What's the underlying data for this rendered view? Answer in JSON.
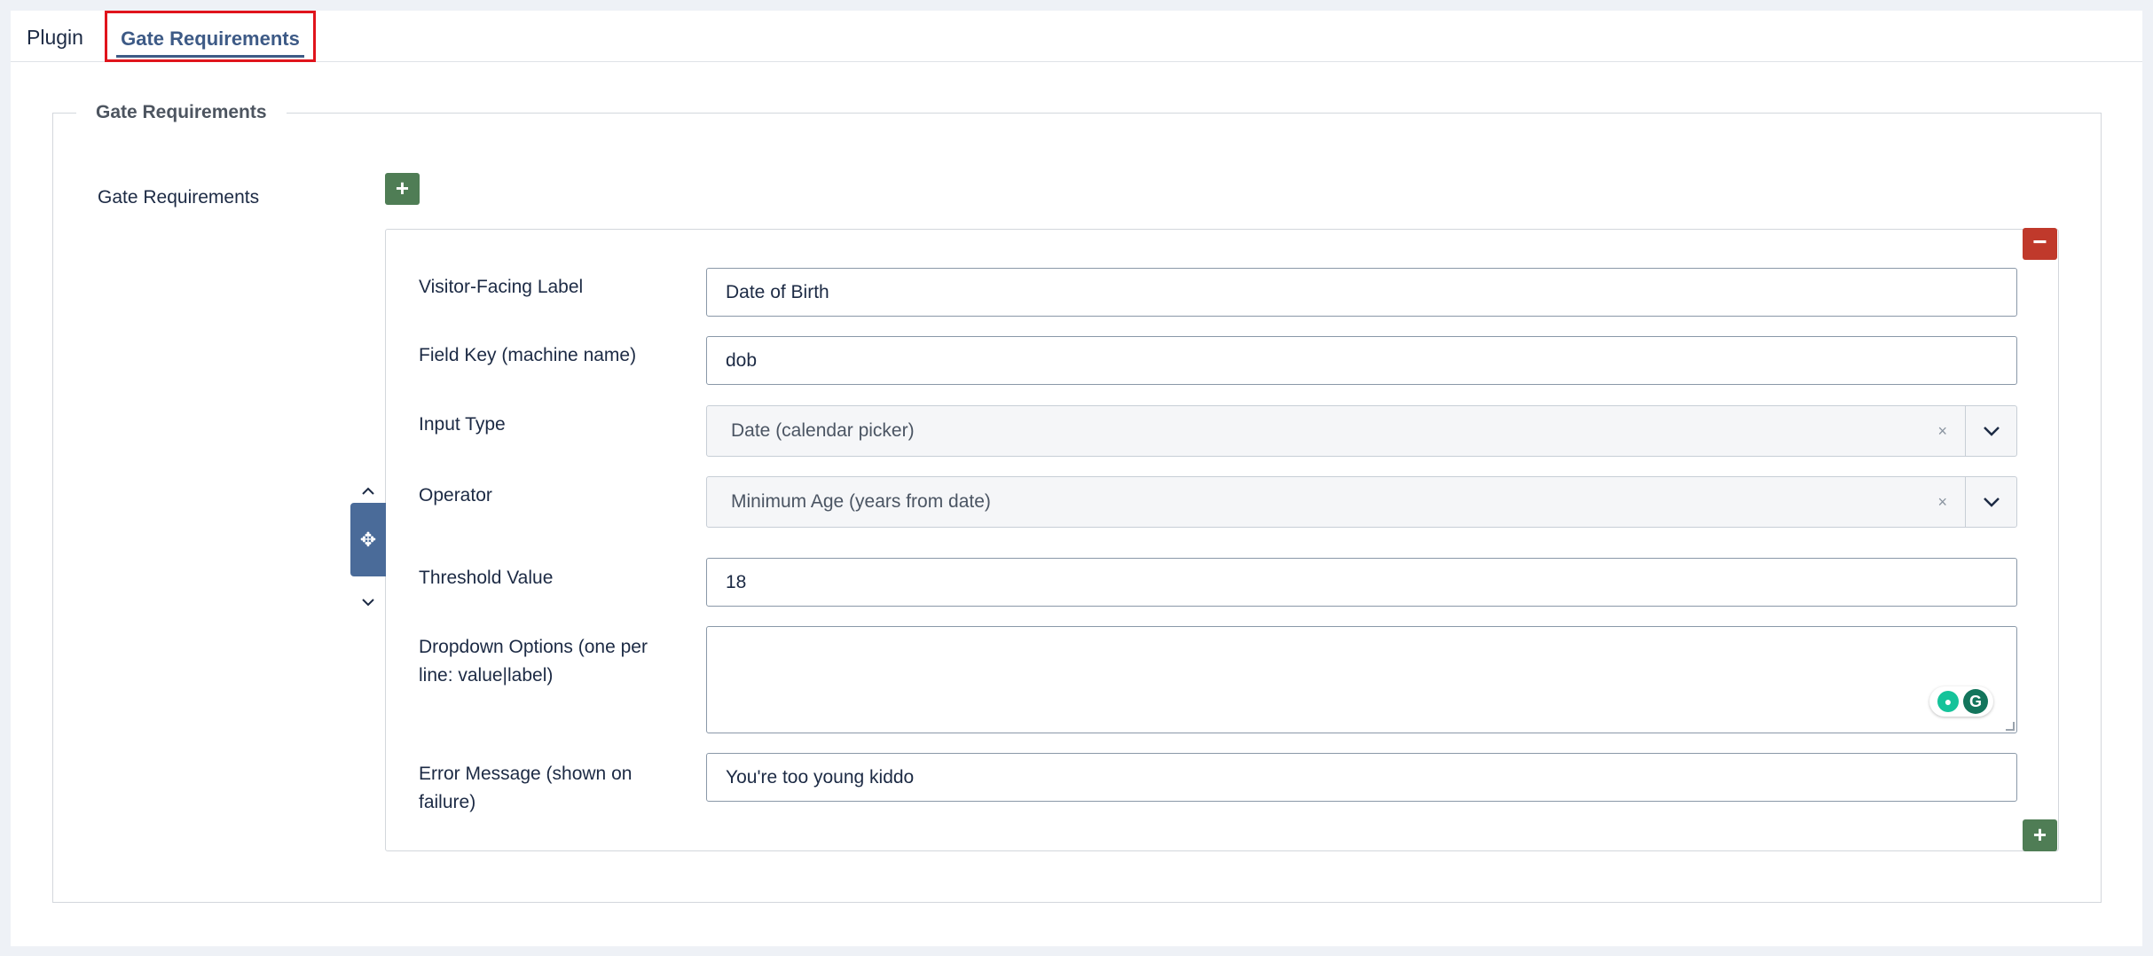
{
  "tabs": [
    {
      "label": "Plugin"
    },
    {
      "label": "Gate Requirements"
    }
  ],
  "fieldset": {
    "legend": "Gate Requirements",
    "field_label": "Gate Requirements"
  },
  "controls": {
    "add_icon": "+",
    "remove_icon": "−",
    "move_icon": "✥",
    "up_icon": "⌃",
    "down_icon": "⌄"
  },
  "row": {
    "visitor_label": {
      "label": "Visitor-Facing Label",
      "value": "Date of Birth"
    },
    "field_key": {
      "label": "Field Key (machine name)",
      "value": "dob"
    },
    "input_type": {
      "label": "Input Type",
      "value": "Date (calendar picker)",
      "clear": "×"
    },
    "operator": {
      "label": "Operator",
      "value": "Minimum Age (years from date)",
      "clear": "×"
    },
    "threshold": {
      "label": "Threshold Value",
      "value": "18"
    },
    "dropdown_options": {
      "label_line1": "Dropdown Options (one per",
      "label_line2": "line: value|label)",
      "value": ""
    },
    "error_message": {
      "label_line1": "Error Message (shown on",
      "label_line2": "failure)",
      "value": "You're too young kiddo"
    }
  },
  "grammarly": {
    "logo": "G"
  },
  "colors": {
    "active_tab": "#3d5a86",
    "highlight_box": "#e0141c",
    "add_button": "#4f7d55",
    "remove_button": "#c0392b",
    "drag_handle": "#4a6b99"
  }
}
